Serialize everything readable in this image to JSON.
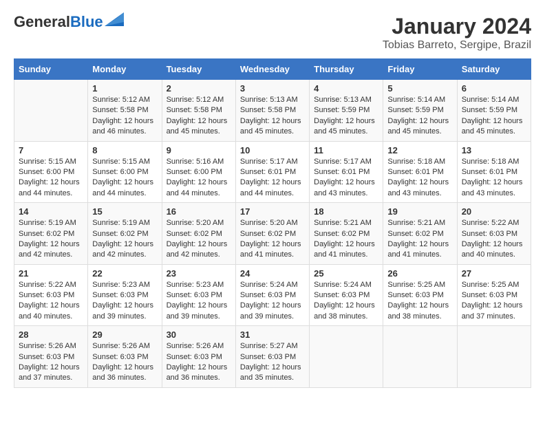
{
  "header": {
    "logo_general": "General",
    "logo_blue": "Blue",
    "main_title": "January 2024",
    "subtitle": "Tobias Barreto, Sergipe, Brazil"
  },
  "calendar": {
    "days_of_week": [
      "Sunday",
      "Monday",
      "Tuesday",
      "Wednesday",
      "Thursday",
      "Friday",
      "Saturday"
    ],
    "weeks": [
      [
        {
          "day": "",
          "info": ""
        },
        {
          "day": "1",
          "info": "Sunrise: 5:12 AM\nSunset: 5:58 PM\nDaylight: 12 hours\nand 46 minutes."
        },
        {
          "day": "2",
          "info": "Sunrise: 5:12 AM\nSunset: 5:58 PM\nDaylight: 12 hours\nand 45 minutes."
        },
        {
          "day": "3",
          "info": "Sunrise: 5:13 AM\nSunset: 5:58 PM\nDaylight: 12 hours\nand 45 minutes."
        },
        {
          "day": "4",
          "info": "Sunrise: 5:13 AM\nSunset: 5:59 PM\nDaylight: 12 hours\nand 45 minutes."
        },
        {
          "day": "5",
          "info": "Sunrise: 5:14 AM\nSunset: 5:59 PM\nDaylight: 12 hours\nand 45 minutes."
        },
        {
          "day": "6",
          "info": "Sunrise: 5:14 AM\nSunset: 5:59 PM\nDaylight: 12 hours\nand 45 minutes."
        }
      ],
      [
        {
          "day": "7",
          "info": "Sunrise: 5:15 AM\nSunset: 6:00 PM\nDaylight: 12 hours\nand 44 minutes."
        },
        {
          "day": "8",
          "info": "Sunrise: 5:15 AM\nSunset: 6:00 PM\nDaylight: 12 hours\nand 44 minutes."
        },
        {
          "day": "9",
          "info": "Sunrise: 5:16 AM\nSunset: 6:00 PM\nDaylight: 12 hours\nand 44 minutes."
        },
        {
          "day": "10",
          "info": "Sunrise: 5:17 AM\nSunset: 6:01 PM\nDaylight: 12 hours\nand 44 minutes."
        },
        {
          "day": "11",
          "info": "Sunrise: 5:17 AM\nSunset: 6:01 PM\nDaylight: 12 hours\nand 43 minutes."
        },
        {
          "day": "12",
          "info": "Sunrise: 5:18 AM\nSunset: 6:01 PM\nDaylight: 12 hours\nand 43 minutes."
        },
        {
          "day": "13",
          "info": "Sunrise: 5:18 AM\nSunset: 6:01 PM\nDaylight: 12 hours\nand 43 minutes."
        }
      ],
      [
        {
          "day": "14",
          "info": "Sunrise: 5:19 AM\nSunset: 6:02 PM\nDaylight: 12 hours\nand 42 minutes."
        },
        {
          "day": "15",
          "info": "Sunrise: 5:19 AM\nSunset: 6:02 PM\nDaylight: 12 hours\nand 42 minutes."
        },
        {
          "day": "16",
          "info": "Sunrise: 5:20 AM\nSunset: 6:02 PM\nDaylight: 12 hours\nand 42 minutes."
        },
        {
          "day": "17",
          "info": "Sunrise: 5:20 AM\nSunset: 6:02 PM\nDaylight: 12 hours\nand 41 minutes."
        },
        {
          "day": "18",
          "info": "Sunrise: 5:21 AM\nSunset: 6:02 PM\nDaylight: 12 hours\nand 41 minutes."
        },
        {
          "day": "19",
          "info": "Sunrise: 5:21 AM\nSunset: 6:02 PM\nDaylight: 12 hours\nand 41 minutes."
        },
        {
          "day": "20",
          "info": "Sunrise: 5:22 AM\nSunset: 6:03 PM\nDaylight: 12 hours\nand 40 minutes."
        }
      ],
      [
        {
          "day": "21",
          "info": "Sunrise: 5:22 AM\nSunset: 6:03 PM\nDaylight: 12 hours\nand 40 minutes."
        },
        {
          "day": "22",
          "info": "Sunrise: 5:23 AM\nSunset: 6:03 PM\nDaylight: 12 hours\nand 39 minutes."
        },
        {
          "day": "23",
          "info": "Sunrise: 5:23 AM\nSunset: 6:03 PM\nDaylight: 12 hours\nand 39 minutes."
        },
        {
          "day": "24",
          "info": "Sunrise: 5:24 AM\nSunset: 6:03 PM\nDaylight: 12 hours\nand 39 minutes."
        },
        {
          "day": "25",
          "info": "Sunrise: 5:24 AM\nSunset: 6:03 PM\nDaylight: 12 hours\nand 38 minutes."
        },
        {
          "day": "26",
          "info": "Sunrise: 5:25 AM\nSunset: 6:03 PM\nDaylight: 12 hours\nand 38 minutes."
        },
        {
          "day": "27",
          "info": "Sunrise: 5:25 AM\nSunset: 6:03 PM\nDaylight: 12 hours\nand 37 minutes."
        }
      ],
      [
        {
          "day": "28",
          "info": "Sunrise: 5:26 AM\nSunset: 6:03 PM\nDaylight: 12 hours\nand 37 minutes."
        },
        {
          "day": "29",
          "info": "Sunrise: 5:26 AM\nSunset: 6:03 PM\nDaylight: 12 hours\nand 36 minutes."
        },
        {
          "day": "30",
          "info": "Sunrise: 5:26 AM\nSunset: 6:03 PM\nDaylight: 12 hours\nand 36 minutes."
        },
        {
          "day": "31",
          "info": "Sunrise: 5:27 AM\nSunset: 6:03 PM\nDaylight: 12 hours\nand 35 minutes."
        },
        {
          "day": "",
          "info": ""
        },
        {
          "day": "",
          "info": ""
        },
        {
          "day": "",
          "info": ""
        }
      ]
    ]
  }
}
